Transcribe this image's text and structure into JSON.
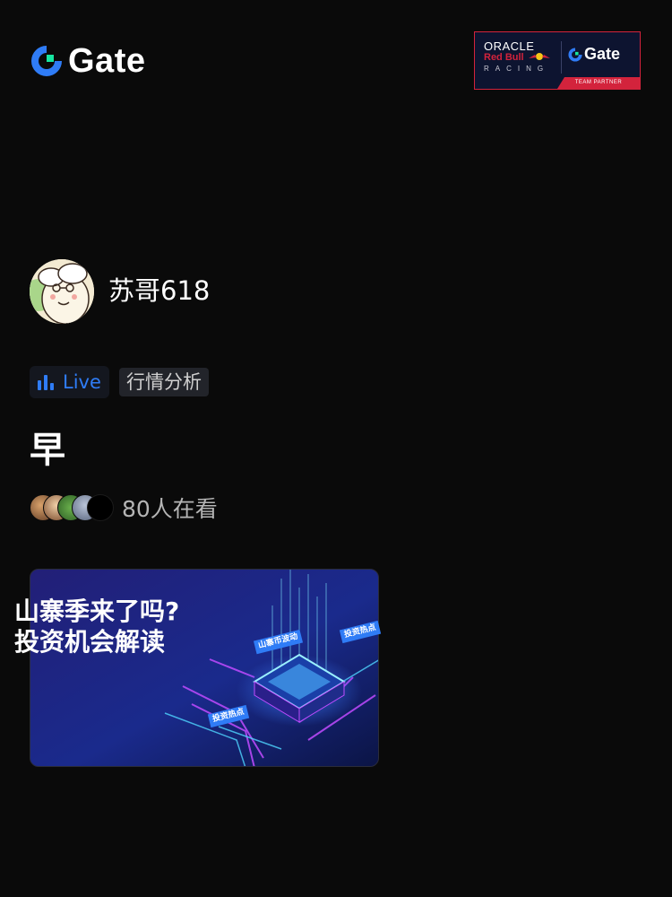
{
  "header": {
    "logo_text": "Gate",
    "partner": {
      "oracle": "ORACLE",
      "red_bull": "Red Bull",
      "racing": "RACING",
      "gate": "Gate",
      "team_partner": "TEAM PARTNER"
    }
  },
  "host": {
    "name": "苏哥618"
  },
  "tags": {
    "live": "Live",
    "category": "行情分析"
  },
  "stream": {
    "title": "早",
    "viewers": "80人在看"
  },
  "cover": {
    "headline_line1": "山寨季来了吗?",
    "headline_line2": "投资机会解读",
    "chip_market": "山寨币波动",
    "chip_hot_right": "投资热点",
    "chip_hot_left": "投资热点"
  },
  "colors": {
    "background": "#0a0a0a",
    "accent_blue": "#2f7cf6",
    "gate_green": "#17e6a1",
    "red_bull_red": "#d3233c"
  },
  "icons": {
    "live": "bar-chart-icon",
    "logo": "gate-logo-icon"
  }
}
